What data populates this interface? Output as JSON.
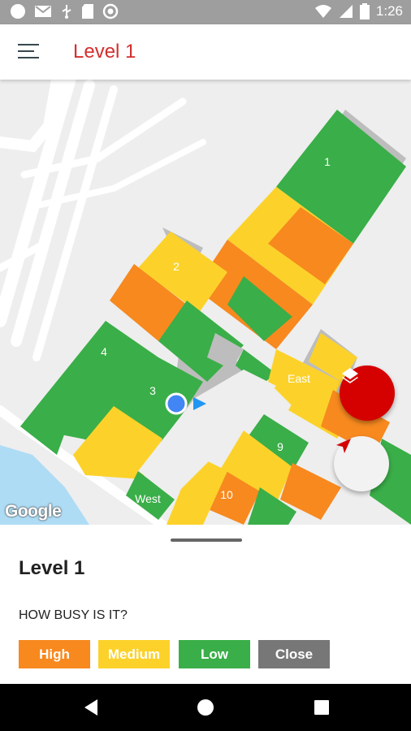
{
  "status_bar": {
    "time": "1:26",
    "icons": [
      "notification-circle-icon",
      "gmail-icon",
      "usb-icon",
      "sd-card-icon",
      "sync-circle-icon",
      "wifi-icon",
      "signal-icon",
      "battery-icon"
    ]
  },
  "app_bar": {
    "title": "Level 1",
    "menu_icon": "hamburger-menu-icon"
  },
  "map": {
    "building_labels": [
      "1",
      "2",
      "4",
      "3",
      "9",
      "10",
      "East",
      "West"
    ],
    "attribution": "Google",
    "layers_icon": "layers-icon",
    "navigation_icon": "navigation-arrow-icon",
    "colors": {
      "high": "#f7891f",
      "medium": "#fcd22a",
      "low": "#3aae48",
      "close": "#777777",
      "background": "#eeeeee",
      "accent": "#d50000"
    }
  },
  "sheet": {
    "title": "Level 1",
    "question": "HOW BUSY IS IT?",
    "buttons": [
      {
        "label": "High",
        "color": "#f7891f"
      },
      {
        "label": "Medium",
        "color": "#fcd22a"
      },
      {
        "label": "Low",
        "color": "#3aae48"
      },
      {
        "label": "Close",
        "color": "#777777"
      }
    ]
  },
  "nav_bar": {
    "icons": [
      "back-icon",
      "home-icon",
      "recents-icon"
    ]
  }
}
